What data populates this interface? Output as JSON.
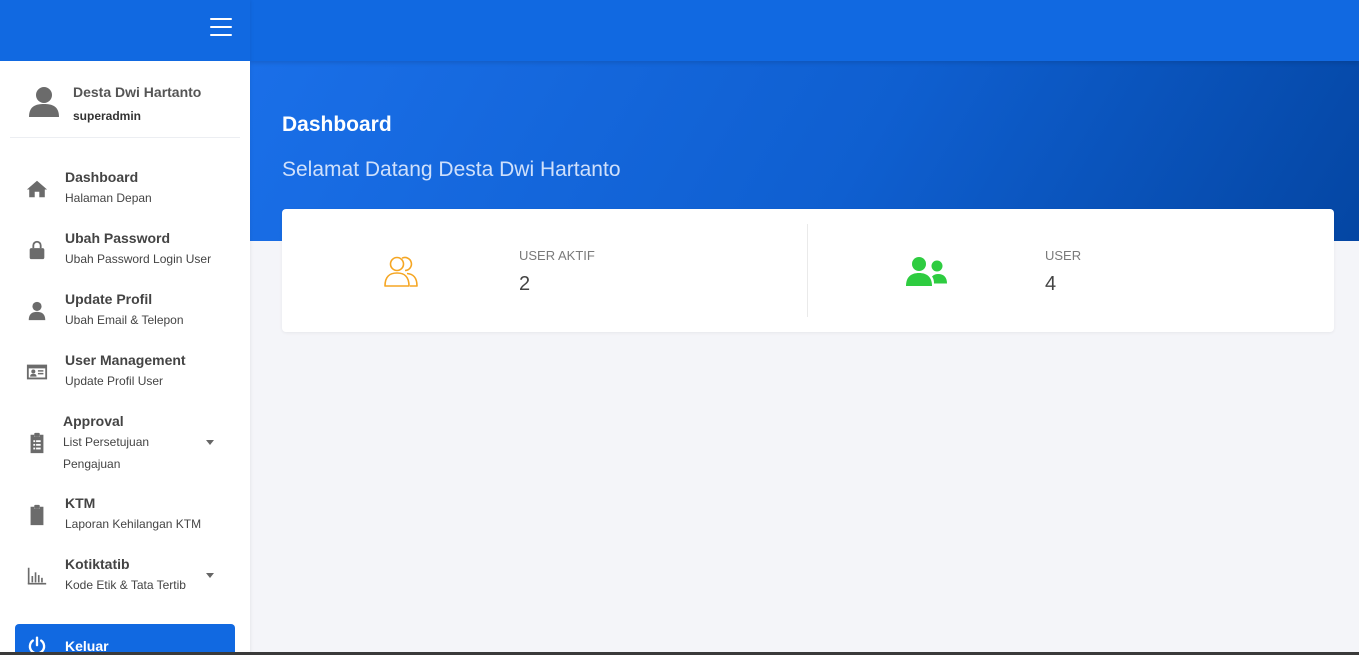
{
  "user": {
    "name": "Desta Dwi Hartanto",
    "role": "superadmin"
  },
  "menu": [
    {
      "title": "Dashboard",
      "subtitle": "Halaman Depan",
      "icon": "home-icon"
    },
    {
      "title": "Ubah Password",
      "subtitle": "Ubah Password Login User",
      "icon": "lock-icon"
    },
    {
      "title": "Update Profil",
      "subtitle": "Ubah Email & Telepon",
      "icon": "user-icon"
    },
    {
      "title": "User Management",
      "subtitle": "Update Profil User",
      "icon": "id-card-icon"
    },
    {
      "title": "Approval",
      "subtitle": "List Persetujuan",
      "subtitle2": "Pengajuan",
      "icon": "clipboard-list-icon",
      "has_dropdown": true
    },
    {
      "title": "KTM",
      "subtitle": "Laporan Kehilangan KTM",
      "icon": "clipboard-icon"
    },
    {
      "title": "Kotiktatib",
      "subtitle": "Kode Etik & Tata Tertib",
      "icon": "chart-icon",
      "has_dropdown": true
    }
  ],
  "logout": {
    "label": "Keluar",
    "icon": "power-icon"
  },
  "header": {
    "title": "Dashboard",
    "subtitle": "Selamat Datang Desta Dwi Hartanto"
  },
  "stats": [
    {
      "label": "USER AKTIF",
      "value": "2",
      "icon": "users-outline-icon",
      "color": "#f5a623"
    },
    {
      "label": "USER",
      "value": "4",
      "icon": "users-icon",
      "color": "#2ecc40"
    }
  ],
  "colors": {
    "primary": "#1169e1",
    "header_dark": "#0446a3",
    "background": "#f4f5f9"
  }
}
